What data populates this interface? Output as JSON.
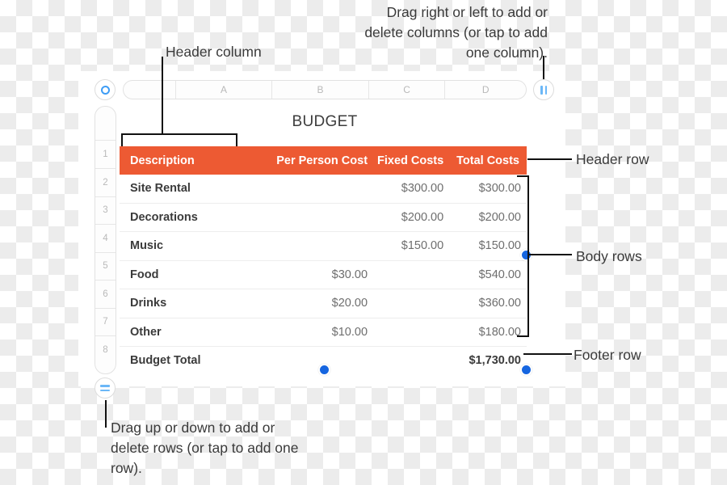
{
  "sheet": {
    "title": "BUDGET",
    "column_headers": [
      "",
      "A",
      "B",
      "C",
      "D"
    ],
    "row_numbers": [
      "",
      "1",
      "2",
      "3",
      "4",
      "5",
      "6",
      "7",
      "8"
    ]
  },
  "table": {
    "header_row": {
      "description": "Description",
      "per_person_cost": "Per Person Cost",
      "fixed_costs": "Fixed Costs",
      "total_costs": "Total Costs"
    },
    "body_rows": [
      {
        "description": "Site Rental",
        "per_person_cost": "",
        "fixed_costs": "$300.00",
        "total_costs": "$300.00"
      },
      {
        "description": "Decorations",
        "per_person_cost": "",
        "fixed_costs": "$200.00",
        "total_costs": "$200.00"
      },
      {
        "description": "Music",
        "per_person_cost": "",
        "fixed_costs": "$150.00",
        "total_costs": "$150.00"
      },
      {
        "description": "Food",
        "per_person_cost": "$30.00",
        "fixed_costs": "",
        "total_costs": "$540.00"
      },
      {
        "description": "Drinks",
        "per_person_cost": "$20.00",
        "fixed_costs": "",
        "total_costs": "$360.00"
      },
      {
        "description": "Other",
        "per_person_cost": "$10.00",
        "fixed_costs": "",
        "total_costs": "$180.00"
      }
    ],
    "footer_row": {
      "description": "Budget Total",
      "per_person_cost": "",
      "fixed_costs": "",
      "total_costs": "$1,730.00"
    }
  },
  "annotations": {
    "columns_hint": "Drag right or left to add or delete columns (or tap to add one column).",
    "rows_hint": "Drag up or down to add or delete rows (or tap to add one row).",
    "header_column": "Header column",
    "header_row": "Header row",
    "body_rows": "Body rows",
    "footer_row": "Footer row"
  },
  "colors": {
    "header_orange": "#ed5a33",
    "handle_blue": "#3d9cf5",
    "selection_dot_blue": "#1565e0",
    "leader_line": "#111111"
  }
}
